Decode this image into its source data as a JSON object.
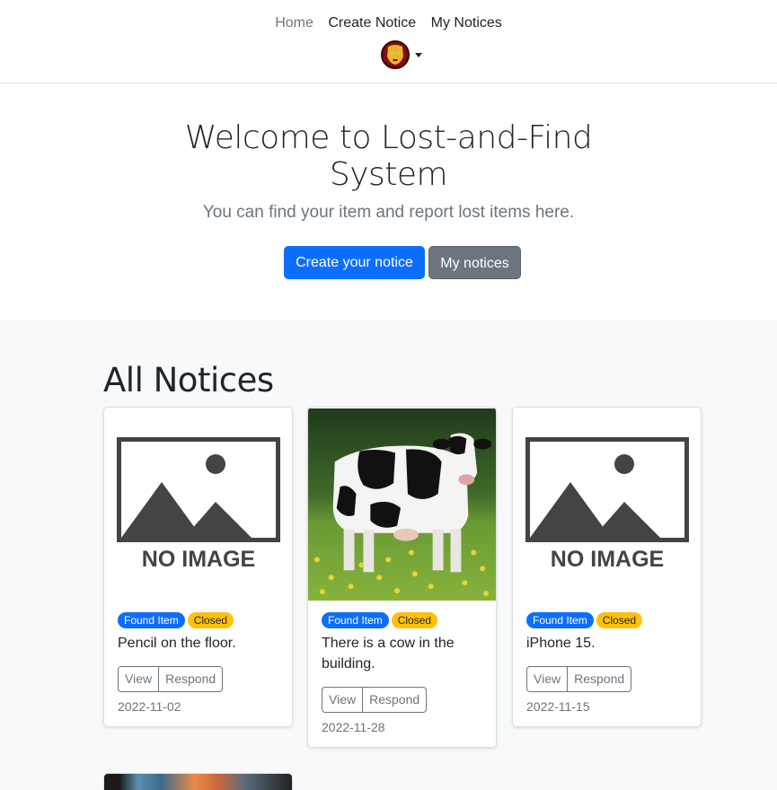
{
  "nav": {
    "links": [
      "Home",
      "Create Notice",
      "My Notices"
    ],
    "avatar_icon": "iron-man-avatar-icon"
  },
  "hero": {
    "title": "Welcome to Lost-and-Find System",
    "lead": "You can find your item and report lost items here.",
    "primary_button": "Create your notice",
    "secondary_button": "My notices"
  },
  "notices": {
    "title": "All Notices",
    "view_label": "View",
    "respond_label": "Respond",
    "no_image_label": "NO IMAGE",
    "cards": [
      {
        "type_badge": "Found Item",
        "status_badge": "Closed",
        "text": "Pencil on the floor.",
        "date": "2022-11-02",
        "image": "no-image"
      },
      {
        "type_badge": "Found Item",
        "status_badge": "Closed",
        "text": "There is a cow in the building.",
        "date": "2022-11-28",
        "image": "cow-photo"
      },
      {
        "type_badge": "Found Item",
        "status_badge": "Closed",
        "text": "iPhone 15.",
        "date": "2022-11-15",
        "image": "no-image"
      }
    ]
  },
  "colors": {
    "primary": "#0d6efd",
    "secondary": "#6c757d",
    "warning": "#ffc107",
    "section_bg": "#f8f9fa"
  }
}
